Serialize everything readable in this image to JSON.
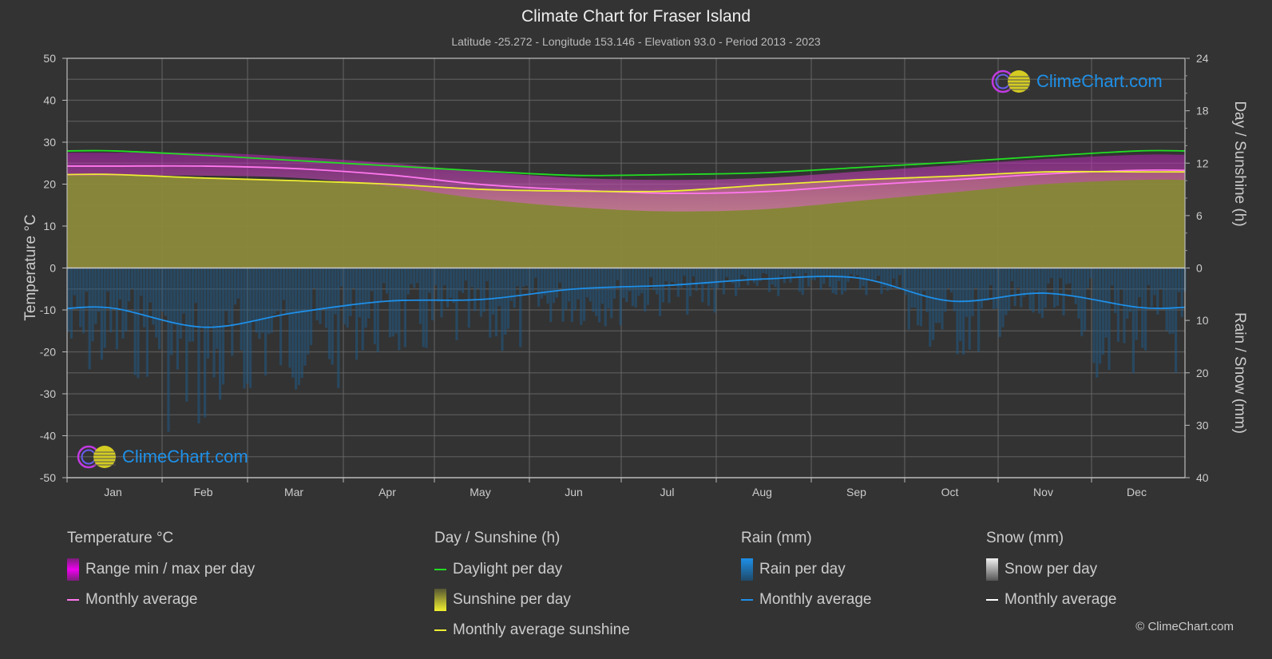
{
  "header": {
    "title": "Climate Chart for Fraser Island",
    "subtitle": "Latitude -25.272 - Longitude 153.146 - Elevation 93.0 - Period 2013 - 2023"
  },
  "logo": {
    "text": "ClimeChart.com"
  },
  "copyright": "© ClimeChart.com",
  "legend": {
    "temperature": {
      "title": "Temperature °C",
      "items": [
        "Range min / max per day",
        "Monthly average"
      ]
    },
    "sunshine": {
      "title": "Day / Sunshine (h)",
      "items": [
        "Daylight per day",
        "Sunshine per day",
        "Monthly average sunshine"
      ]
    },
    "rain": {
      "title": "Rain (mm)",
      "items": [
        "Rain per day",
        "Monthly average"
      ]
    },
    "snow": {
      "title": "Snow (mm)",
      "items": [
        "Snow per day",
        "Monthly average"
      ]
    }
  },
  "colors": {
    "background": "#333333",
    "daylight": "#22dd22",
    "sunshine_avg": "#eeee33",
    "sunshine_fill": "#8c8a3a",
    "temp_avg": "#ff77ee",
    "temp_range": "#cc22cc",
    "rain_avg": "#1e8fe8",
    "rain_fill": "#1f5a86",
    "snow_avg": "#ffffff"
  },
  "chart_data": {
    "type": "area",
    "title": "Climate Chart for Fraser Island",
    "categories": [
      "Jan",
      "Feb",
      "Mar",
      "Apr",
      "May",
      "Jun",
      "Jul",
      "Aug",
      "Sep",
      "Oct",
      "Nov",
      "Dec"
    ],
    "left_axis": {
      "label": "Temperature °C",
      "range": [
        -50,
        50
      ],
      "ticks": [
        50,
        40,
        30,
        20,
        10,
        0,
        -10,
        -20,
        -30,
        -40,
        -50
      ]
    },
    "right_axis_top": {
      "label": "Day / Sunshine (h)",
      "range": [
        0,
        24
      ],
      "ticks": [
        24,
        18,
        12,
        6,
        0
      ]
    },
    "right_axis_bottom": {
      "label": "Rain / Snow (mm)",
      "range": [
        0,
        40
      ],
      "ticks": [
        0,
        10,
        20,
        30,
        40
      ]
    },
    "grid": true,
    "series": [
      {
        "name": "Daylight per day",
        "axis": "hours",
        "values": [
          13.4,
          12.9,
          12.3,
          11.7,
          11.1,
          10.6,
          10.7,
          10.9,
          11.5,
          12.1,
          12.8,
          13.4
        ]
      },
      {
        "name": "Monthly average sunshine",
        "axis": "hours",
        "values": [
          10.7,
          10.3,
          10.0,
          9.6,
          9.0,
          8.8,
          8.8,
          9.5,
          10.1,
          10.5,
          11.0,
          11.0
        ]
      },
      {
        "name": "Temperature monthly average",
        "axis": "temperature",
        "values": [
          24.3,
          24.3,
          23.7,
          22.2,
          19.9,
          18.6,
          17.8,
          18.2,
          19.7,
          21.0,
          22.4,
          23.3
        ]
      },
      {
        "name": "Temperature max per day (approx)",
        "axis": "temperature",
        "values": [
          27.5,
          27.5,
          26.5,
          25.0,
          23.0,
          21.5,
          21.0,
          21.5,
          23.0,
          24.5,
          26.0,
          27.0
        ]
      },
      {
        "name": "Temperature min per day (approx)",
        "axis": "temperature",
        "values": [
          22.0,
          22.0,
          21.5,
          19.5,
          16.5,
          14.5,
          13.5,
          14.0,
          16.0,
          18.0,
          20.0,
          21.0
        ]
      },
      {
        "name": "Rain monthly average",
        "axis": "rain",
        "values": [
          7.7,
          11.3,
          8.5,
          6.3,
          6.0,
          4.0,
          3.3,
          2.1,
          1.9,
          6.3,
          4.8,
          7.5
        ]
      },
      {
        "name": "Snow monthly average",
        "axis": "rain",
        "values": [
          0,
          0,
          0,
          0,
          0,
          0,
          0,
          0,
          0,
          0,
          0,
          0
        ]
      }
    ]
  }
}
